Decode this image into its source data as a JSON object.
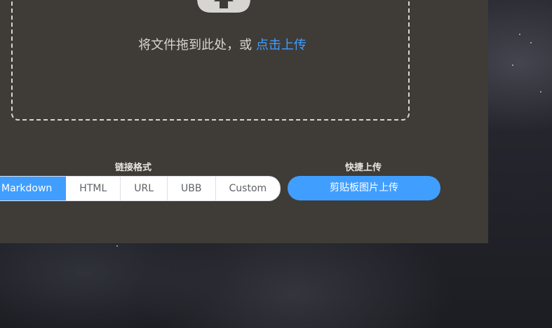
{
  "dropzone": {
    "text": "将文件拖到此处，或 ",
    "link": "点击上传",
    "icon": "cloud-upload-icon"
  },
  "link_format": {
    "label": "链接格式",
    "options": [
      "Markdown",
      "HTML",
      "URL",
      "UBB",
      "Custom"
    ],
    "selected": "Markdown"
  },
  "quick_upload": {
    "label": "快捷上传",
    "button": "剪贴板图片上传"
  },
  "colors": {
    "panel": "#3f3b37",
    "accent": "#409eff"
  }
}
